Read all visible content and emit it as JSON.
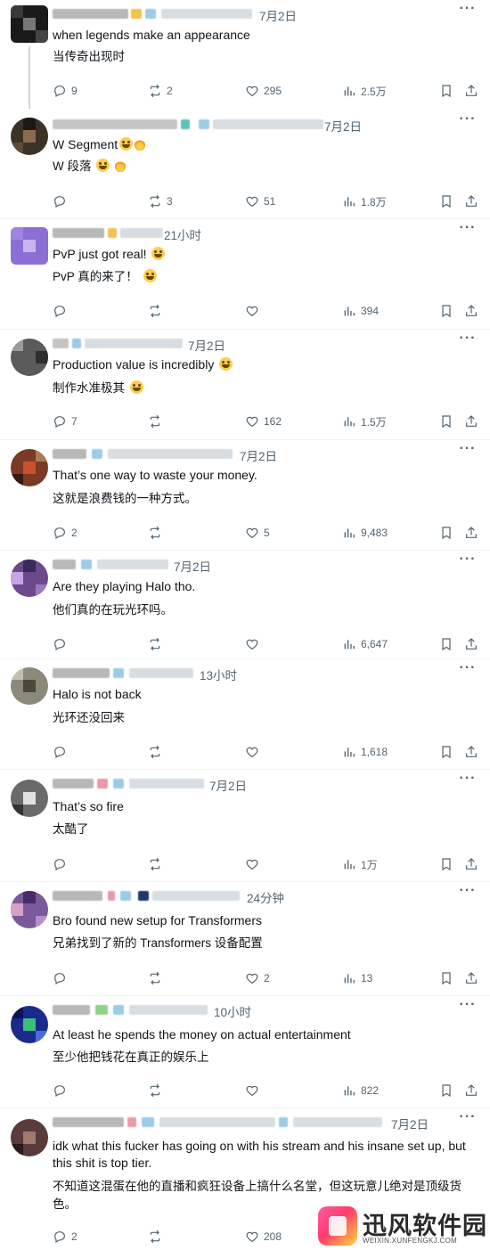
{
  "tweets": [
    {
      "time": "7月2日",
      "text_en": "when legends make an appearance",
      "text_zh": "当传奇出现时",
      "replies": "9",
      "retweets": "2",
      "likes": "295",
      "views": "2.5万",
      "emoji": "",
      "emoji_zh": ""
    },
    {
      "time": "7月2日",
      "text_en": "W Segment",
      "text_zh": "W 段落",
      "replies": "",
      "retweets": "3",
      "likes": "51",
      "views": "1.8万",
      "emoji": "laugh-cry fire",
      "emoji_zh": "laugh-cry fire"
    },
    {
      "time": "21小时",
      "text_en": "PvP just got real!",
      "text_zh": "PvP 真的来了！",
      "replies": "",
      "retweets": "",
      "likes": "",
      "views": "394",
      "emoji": "laugh-cry",
      "emoji_zh": "laugh-cry"
    },
    {
      "time": "7月2日",
      "text_en": "Production value is incredibly",
      "text_zh": "制作水准极其",
      "replies": "7",
      "retweets": "",
      "likes": "162",
      "views": "1.5万",
      "emoji": "laugh-cry",
      "emoji_zh": "laugh-cry"
    },
    {
      "time": "7月2日",
      "text_en": "That’s one way to waste your money.",
      "text_zh": "这就是浪费钱的一种方式。",
      "replies": "2",
      "retweets": "",
      "likes": "5",
      "views": "9,483",
      "emoji": "",
      "emoji_zh": ""
    },
    {
      "time": "7月2日",
      "text_en": "Are they playing Halo tho.",
      "text_zh": "他们真的在玩光环吗。",
      "replies": "",
      "retweets": "",
      "likes": "",
      "views": "6,647",
      "emoji": "",
      "emoji_zh": ""
    },
    {
      "time": "13小时",
      "text_en": "Halo is not back",
      "text_zh": "光环还没回来",
      "replies": "",
      "retweets": "",
      "likes": "",
      "views": "1,618",
      "emoji": "",
      "emoji_zh": ""
    },
    {
      "time": "7月2日",
      "text_en": "That’s so fire",
      "text_zh": "太酷了",
      "replies": "",
      "retweets": "",
      "likes": "",
      "views": "1万",
      "emoji": "",
      "emoji_zh": ""
    },
    {
      "time": "24分钟",
      "text_en": "Bro found new setup for Transformers",
      "text_zh": "兄弟找到了新的 Transformers 设备配置",
      "replies": "",
      "retweets": "",
      "likes": "2",
      "views": "13",
      "emoji": "",
      "emoji_zh": ""
    },
    {
      "time": "10小时",
      "text_en": "At least he spends the money on actual entertainment",
      "text_zh": "至少他把钱花在真正的娱乐上",
      "replies": "",
      "retweets": "",
      "likes": "",
      "views": "822",
      "emoji": "",
      "emoji_zh": ""
    },
    {
      "time": "7月2日",
      "text_en": "idk what this fucker has going on with his stream and his insane set up, but this shit is top tier.",
      "text_zh": "不知道这混蛋在他的直播和疯狂设备上搞什么名堂，但这玩意儿绝对是顶级货色。",
      "replies": "2",
      "retweets": "",
      "likes": "208",
      "views": "",
      "emoji": "",
      "emoji_zh": ""
    }
  ],
  "watermark": {
    "title": "迅风软件园",
    "url": "WEIXIN.XUNFENGKJ.COM"
  },
  "icons": {
    "more": "more-icon",
    "reply": "reply-icon",
    "retweet": "retweet-icon",
    "like": "like-icon",
    "views": "views-icon",
    "bookmark": "bookmark-icon",
    "share": "share-icon"
  },
  "colors": {
    "text": "#0f1419",
    "muted": "#536471",
    "divider": "#eff3f4"
  }
}
